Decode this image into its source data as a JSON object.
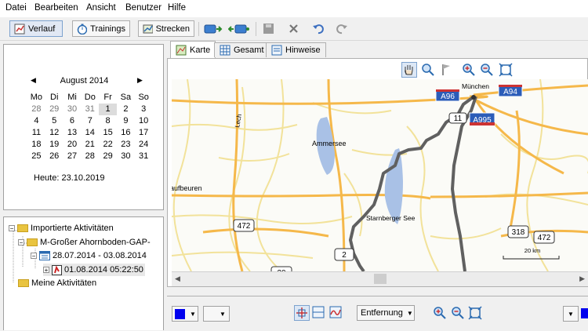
{
  "menu": [
    "Datei",
    "Bearbeiten",
    "Ansicht",
    "Benutzer",
    "Hilfe"
  ],
  "toolbar": {
    "verlauf": "Verlauf",
    "trainings": "Trainings",
    "strecken": "Strecken"
  },
  "calendar": {
    "month": "August 2014",
    "weekdays": [
      "Mo",
      "Di",
      "Mi",
      "Do",
      "Fr",
      "Sa",
      "So"
    ],
    "weeks": [
      [
        "28",
        "29",
        "30",
        "31",
        "1",
        "2",
        "3"
      ],
      [
        "4",
        "5",
        "6",
        "7",
        "8",
        "9",
        "10"
      ],
      [
        "11",
        "12",
        "13",
        "14",
        "15",
        "16",
        "17"
      ],
      [
        "18",
        "19",
        "20",
        "21",
        "22",
        "23",
        "24"
      ],
      [
        "25",
        "26",
        "27",
        "28",
        "29",
        "30",
        "31"
      ]
    ],
    "today": "Heute: 23.10.2019"
  },
  "tree": {
    "root": "Importierte Aktivitäten",
    "folder": "M-Großer Ahornboden-GAP-",
    "week": "28.07.2014 - 03.08.2014",
    "activity": "01.08.2014 05:22:50",
    "other": "Meine Aktivitäten"
  },
  "tabs": [
    "Karte",
    "Gesamt",
    "Hinweise"
  ],
  "map": {
    "labels": {
      "ammersee": "Ammersee",
      "starnberger": "Starnberger See",
      "kaufbeuren": "aufbeuren",
      "lech": "Lech",
      "munich": "München",
      "scale": "20 km"
    },
    "shields": {
      "a96": "A96",
      "a94": "A94",
      "a995": "A995",
      "r472a": "472",
      "r472b": "472",
      "r318": "318",
      "r2": "2",
      "r11": "11",
      "r20": "20"
    },
    "colors": {
      "road": "#f5b84a",
      "minor_road": "#f2e29a",
      "water": "#a9c1e6",
      "route": "#606060",
      "autobahn": "#2b5cb8"
    }
  },
  "bottom": {
    "measure": "Entfernung"
  }
}
